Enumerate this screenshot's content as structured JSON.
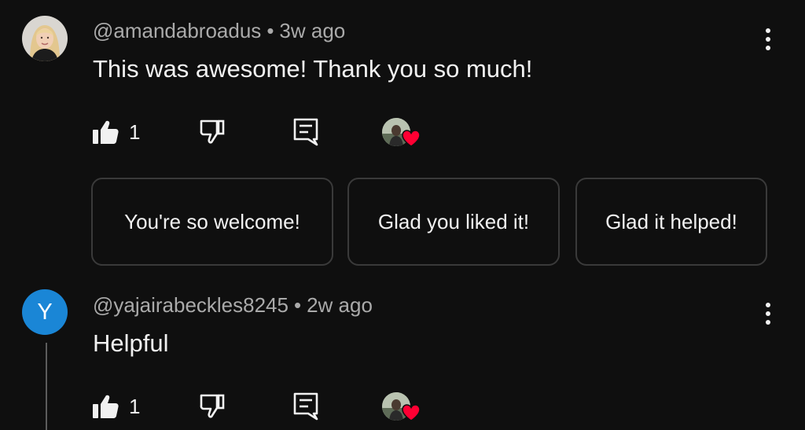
{
  "comments": [
    {
      "author": "@amandabroadus",
      "time": "3w ago",
      "text": "This was awesome! Thank you so much!",
      "likes": "1",
      "avatar_letter": "",
      "has_reply_suggestions": true
    },
    {
      "author": "@yajairabeckles8245",
      "time": "2w ago",
      "text": "Helpful",
      "likes": "1",
      "avatar_letter": "Y",
      "avatar_color": "#1a86d6"
    }
  ],
  "reply_suggestions": [
    "You're so welcome!",
    "Glad you liked it!",
    "Glad it helped!"
  ],
  "separator": "•",
  "icons": {
    "like": "thumbs-up-icon",
    "dislike": "thumbs-down-icon",
    "reply": "reply-icon",
    "more": "more-vertical-icon",
    "creator_heart": "creator-heart-icon"
  },
  "colors": {
    "background": "#0f0f0f",
    "heart": "#ff0033",
    "avatar_blue": "#1a86d6"
  }
}
